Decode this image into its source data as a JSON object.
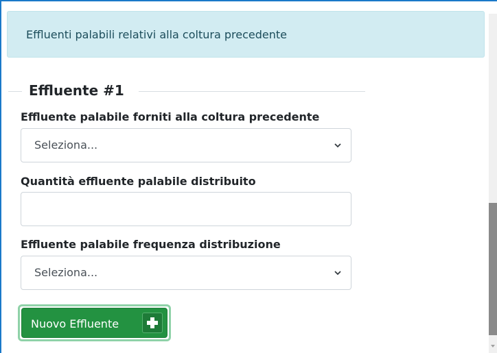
{
  "info_alert": {
    "text": "Effluenti palabili relativi alla coltura precedente"
  },
  "fieldset": {
    "legend": "Effluente #1"
  },
  "fields": {
    "effluent_type": {
      "label": "Effluente palabile forniti alla coltura precedente",
      "selected": "Seleziona..."
    },
    "quantity": {
      "label": "Quantità effluente palabile distribuito",
      "value": ""
    },
    "frequency": {
      "label": "Effluente palabile frequenza distribuzione",
      "selected": "Seleziona..."
    }
  },
  "actions": {
    "new_effluent_label": "Nuovo Effluente",
    "new_effluent_icon": "plus-icon"
  },
  "colors": {
    "alert_bg": "#d2ecf2",
    "button_green": "#239241",
    "window_border": "#1b79c9"
  }
}
